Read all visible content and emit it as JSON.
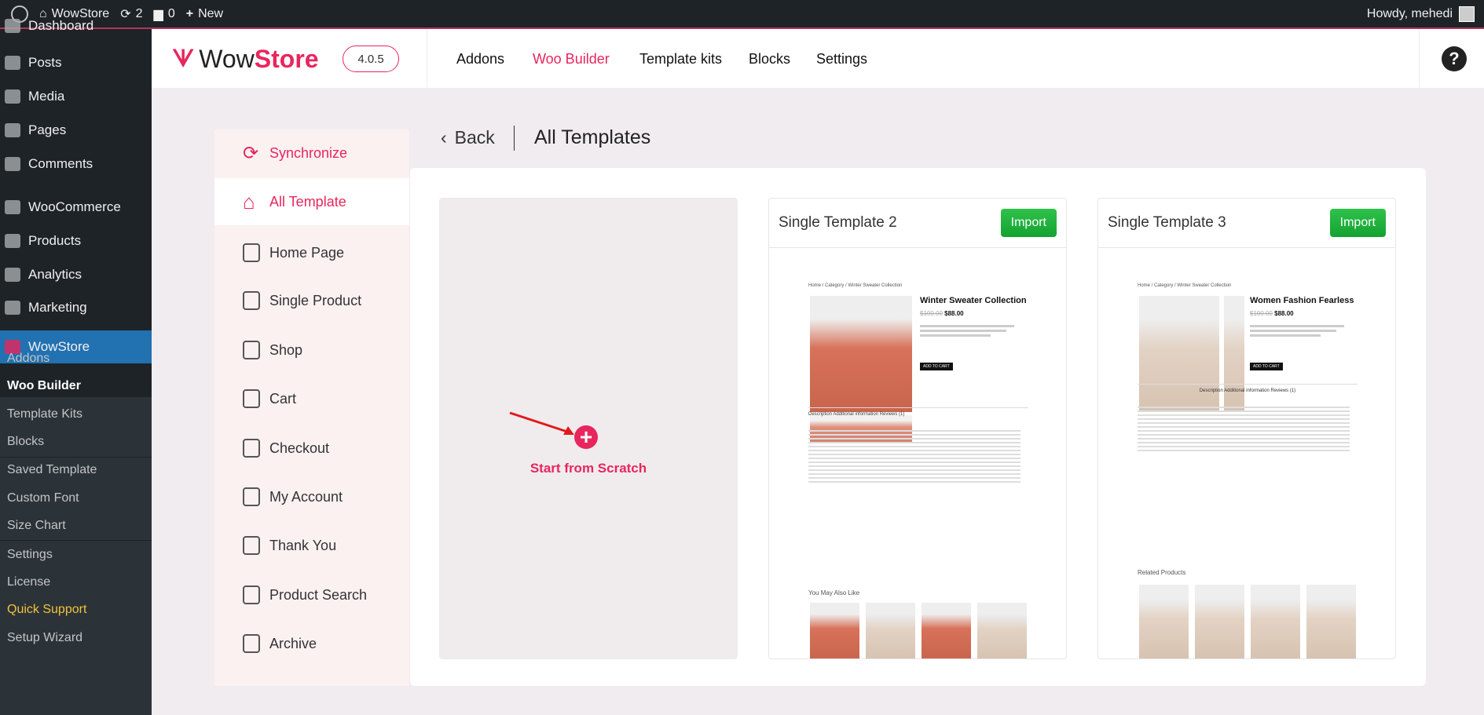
{
  "adminbar": {
    "site": "WowStore",
    "updates": "2",
    "comments": "0",
    "new": "New",
    "howdy": "Howdy, mehedi"
  },
  "wpmenu": {
    "items": [
      "Dashboard",
      "Posts",
      "Media",
      "Pages",
      "Comments",
      "WooCommerce",
      "Products",
      "Analytics",
      "Marketing",
      "WowStore"
    ],
    "submenu": [
      "Addons",
      "Woo Builder",
      "Template Kits",
      "Blocks",
      "Saved Template",
      "Custom Font",
      "Size Chart",
      "Settings",
      "License",
      "Quick Support",
      "Setup Wizard"
    ]
  },
  "header": {
    "logo_a": "Wow",
    "logo_b": "Store",
    "version": "4.0.5",
    "nav": [
      "Addons",
      "Woo Builder",
      "Template kits",
      "Blocks",
      "Settings"
    ],
    "help": "?"
  },
  "leftnav": {
    "items": [
      "Synchronize",
      "All Template",
      "Home Page",
      "Single Product",
      "Shop",
      "Cart",
      "Checkout",
      "My Account",
      "Thank You",
      "Product Search",
      "Archive"
    ]
  },
  "main": {
    "back": "Back",
    "title": "All Templates",
    "scratch": "Start from Scratch",
    "cards": [
      {
        "title": "Single Template 2",
        "import": "Import",
        "product": "Winter Sweater Collection",
        "old_price": "$100.00",
        "price": "$88.00",
        "breadcrumb": "Home / Category / Winter Sweater Collection",
        "tabs": "Description   Additional information   Reviews (1)",
        "related": "You May Also Like",
        "cart": "ADD TO CART"
      },
      {
        "title": "Single Template 3",
        "import": "Import",
        "product": "Women Fashion Fearless",
        "old_price": "$100.00",
        "price": "$88.00",
        "breadcrumb": "Home / Category / Winter Sweater Collection",
        "tabs": "Description   Additional information   Reviews (1)",
        "related": "Related Products",
        "cart": "ADD TO CART"
      }
    ]
  },
  "colors": {
    "accent": "#e8265e",
    "import": "#1fae3c",
    "wp_active": "#2271b1"
  }
}
